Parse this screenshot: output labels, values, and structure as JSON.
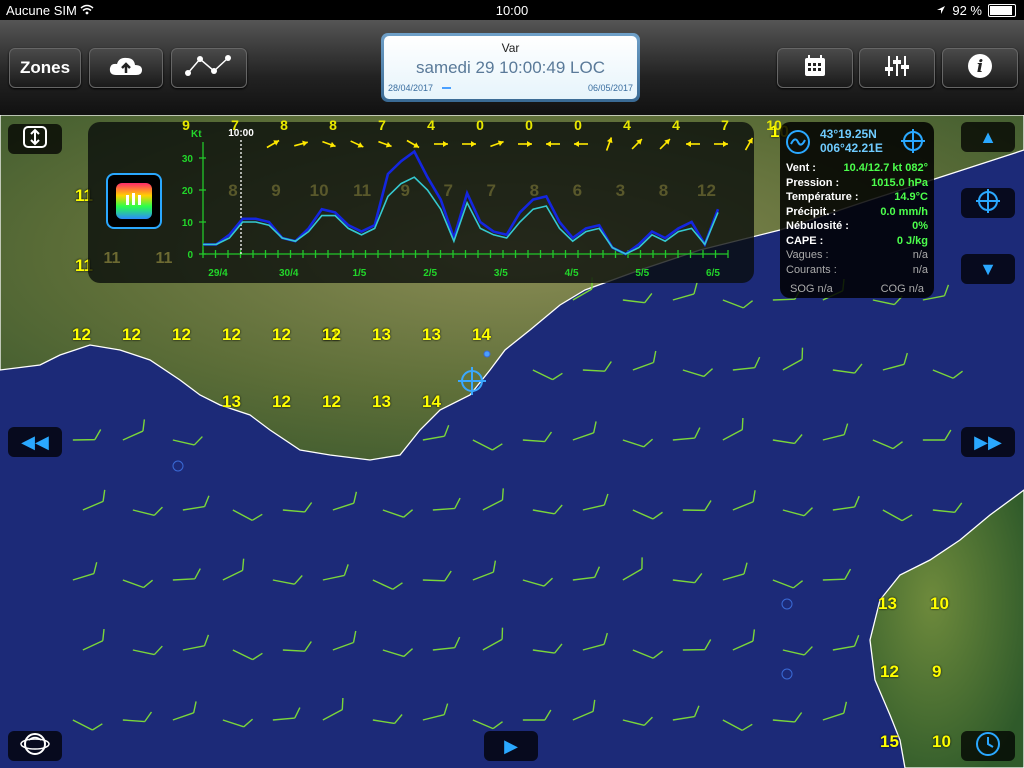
{
  "status_bar": {
    "carrier": "Aucune SIM",
    "time": "10:00",
    "battery": "92 %",
    "battery_level": 0.92
  },
  "toolbar": {
    "zones_label": "Zones",
    "cloud_icon": "cloud-upload-icon",
    "route_icon": "route-icon",
    "calendar_icon": "calendar-icon",
    "settings_icon": "sliders-icon",
    "info_icon": "info-icon"
  },
  "date_display": {
    "region": "Var",
    "datetime": "samedi 29 10:00:49 LOC",
    "start_date": "28/04/2017",
    "end_date": "06/05/2017",
    "progress": 0.05
  },
  "chart_data": {
    "type": "line",
    "ylabel": "Kt",
    "y_ticks": [
      "30",
      "20",
      "10",
      "0"
    ],
    "ylim": [
      0,
      35
    ],
    "current_time_label": "10:00",
    "x_tick_labels": [
      "29/4",
      "30/4",
      "1/5",
      "2/5",
      "3/5",
      "4/5",
      "5/5",
      "6/5"
    ],
    "overlay_numbers": [
      "8",
      "9",
      "10",
      "11",
      "9",
      "7",
      "7",
      "8",
      "6",
      "3",
      "8",
      "12"
    ],
    "series": [
      {
        "values": [
          3,
          3,
          6,
          11,
          11,
          10,
          5,
          4,
          8,
          14,
          13,
          9,
          7,
          9,
          25,
          29,
          32,
          24,
          17,
          5,
          19,
          10,
          7,
          6,
          13,
          17,
          18,
          10,
          5,
          8,
          9,
          2,
          0,
          3,
          7,
          5,
          8,
          10,
          3,
          14
        ]
      },
      {
        "values": [
          3,
          3,
          5,
          10,
          10,
          9,
          5,
          4,
          7,
          12,
          12,
          8,
          6,
          8,
          18,
          22,
          24,
          20,
          14,
          4,
          16,
          8,
          6,
          5,
          10,
          14,
          15,
          8,
          4,
          7,
          8,
          2,
          0,
          2,
          6,
          4,
          7,
          8,
          3,
          13
        ]
      }
    ],
    "direction_numbers": [
      "9",
      "7",
      "8",
      "8",
      "7",
      "4",
      "0",
      "0",
      "0",
      "4",
      "4",
      "7",
      "10"
    ]
  },
  "info_panel": {
    "lat": "43°19.25N",
    "lon": "006°42.21E",
    "rows": [
      {
        "label": "Vent :",
        "value": "10.4/12.7 kt 082°"
      },
      {
        "label": "Pression :",
        "value": "1015.0 hPa"
      },
      {
        "label": "Température :",
        "value": "14.9°C"
      },
      {
        "label": "Précipit. :",
        "value": "0.0 mm/h"
      },
      {
        "label": "Nébulosité :",
        "value": "0%"
      },
      {
        "label": "CAPE :",
        "value": "0 J/kg"
      },
      {
        "label": "Vagues :",
        "value": "n/a"
      },
      {
        "label": "Courants :",
        "value": "n/a"
      }
    ],
    "sog": "SOG n/a",
    "cog": "COG n/a"
  },
  "map_labels": [
    "11",
    "11",
    "12",
    "12",
    "12",
    "12",
    "12",
    "11",
    "12",
    "13",
    "13",
    "14",
    "13",
    "12",
    "12",
    "13",
    "14",
    "10",
    "13",
    "10",
    "12",
    "9",
    "15",
    "10"
  ],
  "left_side_numbers": [
    "11",
    "11"
  ]
}
